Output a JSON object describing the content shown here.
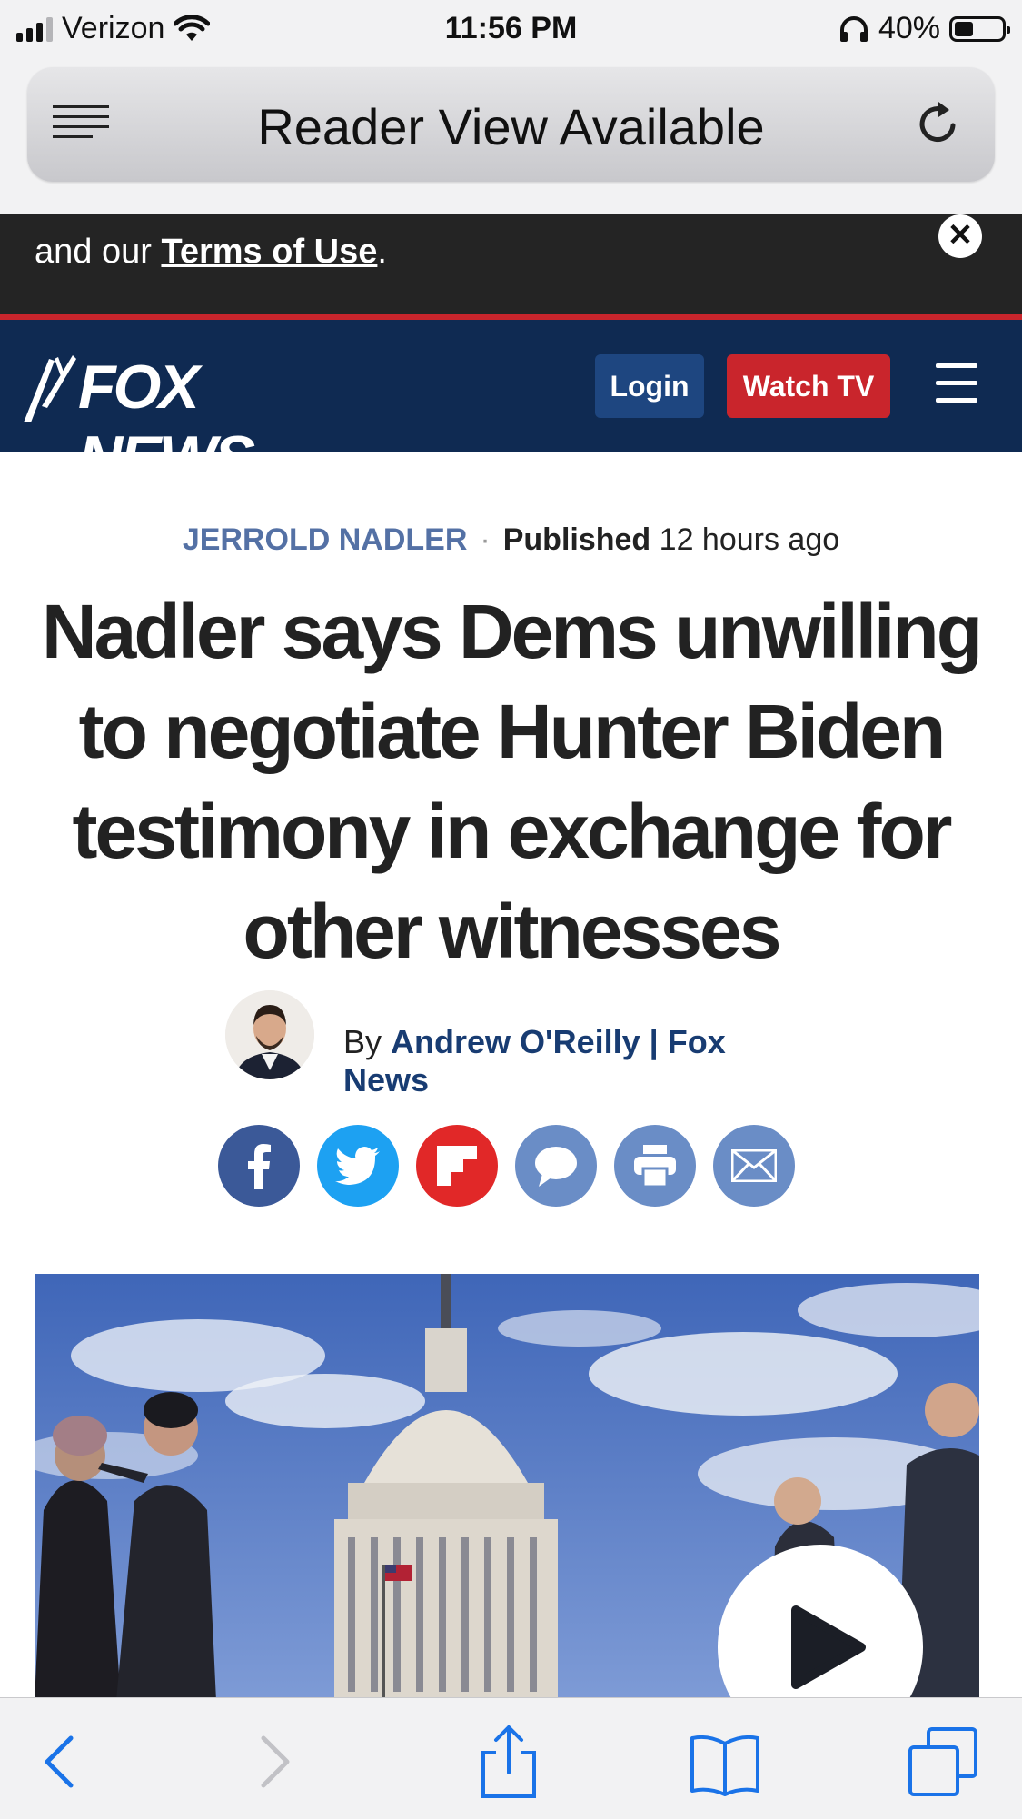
{
  "status_bar": {
    "carrier": "Verizon",
    "time": "11:56 PM",
    "battery": "40%",
    "battery_level": 0.4
  },
  "browser": {
    "reader_label": "Reader View Available"
  },
  "cookie_banner": {
    "text_prefix": "and our ",
    "terms_link": "Terms of Use",
    "text_suffix": ".",
    "close_glyph": "✕"
  },
  "nav": {
    "logo": "FOX NEWS",
    "login": "Login",
    "watch_tv": "Watch TV"
  },
  "article": {
    "category": "JERROLD NADLER",
    "published_label": "Published",
    "published_time": "12 hours ago",
    "headline": "Nadler says Dems unwilling to negotiate Hunter Biden testimony in exchange for other witnesses",
    "by": "By",
    "author": "Andrew O'Reilly | Fox News"
  },
  "share_icons": [
    {
      "name": "facebook-icon",
      "color": "#3b5998"
    },
    {
      "name": "twitter-icon",
      "color": "#1da1f2"
    },
    {
      "name": "flipboard-icon",
      "color": "#e12828"
    },
    {
      "name": "comment-icon",
      "color": "#6a8dc6"
    },
    {
      "name": "print-icon",
      "color": "#6a8dc6"
    },
    {
      "name": "email-icon",
      "color": "#6a8dc6"
    }
  ],
  "colors": {
    "fox_navy": "#0f2a52",
    "fox_red": "#c9252c",
    "category_blue": "#5471a5",
    "ios_blue": "#1a73e8"
  }
}
